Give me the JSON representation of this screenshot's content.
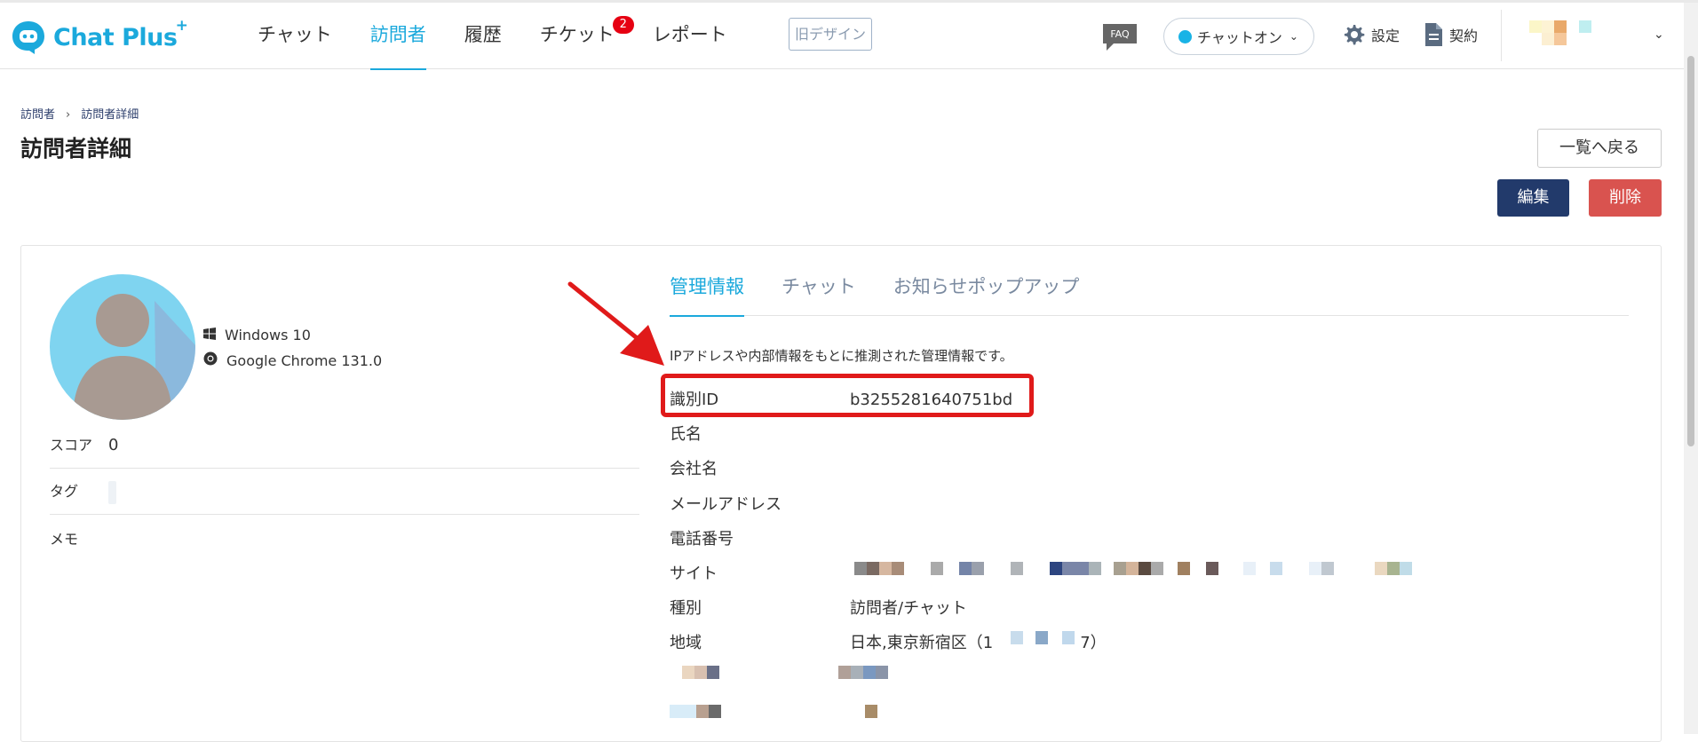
{
  "header": {
    "logo_text": "Chat Plus",
    "logo_sup": "+",
    "nav": [
      {
        "label": "チャット",
        "active": false
      },
      {
        "label": "訪問者",
        "active": true
      },
      {
        "label": "履歴",
        "active": false
      },
      {
        "label": "チケット",
        "active": false,
        "badge": "2"
      },
      {
        "label": "レポート",
        "active": false
      }
    ],
    "old_design": "旧デザイン",
    "faq": "FAQ",
    "chat_status": "チャットオン",
    "settings": "設定",
    "contract": "契約"
  },
  "page": {
    "breadcrumb": [
      "訪問者",
      "訪問者詳細"
    ],
    "breadcrumb_sep": "›",
    "title": "訪問者詳細",
    "back_button": "一覧へ戻る",
    "edit_button": "編集",
    "delete_button": "削除"
  },
  "visitor": {
    "os": "Windows 10",
    "browser": "Google Chrome 131.0",
    "score_label": "スコア",
    "score_value": "0",
    "tag_label": "タグ",
    "memo_label": "メモ"
  },
  "tabs": [
    "管理情報",
    "チャット",
    "お知らせポップアップ"
  ],
  "info": {
    "note": "IPアドレスや内部情報をもとに推測された管理情報です。",
    "rows": [
      {
        "key": "識別ID",
        "value": "b3255281640751bd"
      },
      {
        "key": "氏名",
        "value": ""
      },
      {
        "key": "会社名",
        "value": ""
      },
      {
        "key": "メールアドレス",
        "value": ""
      },
      {
        "key": "電話番号",
        "value": ""
      },
      {
        "key": "サイト",
        "value": ""
      },
      {
        "key": "種別",
        "value": "訪問者/チャット"
      },
      {
        "key": "地域",
        "value": "日本,東京新宿区（1",
        "value_suffix": "7）"
      }
    ]
  },
  "colors": {
    "accent": "#1ba9dc",
    "primary_button": "#223a6b",
    "danger_button": "#d9534f",
    "highlight": "#e01a1a",
    "badge": "#e60012"
  }
}
